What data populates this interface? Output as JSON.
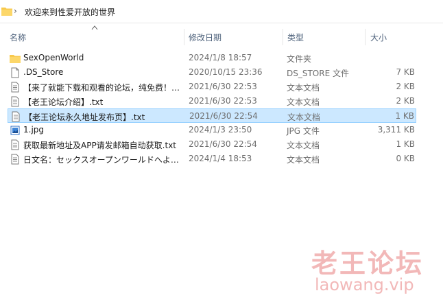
{
  "breadcrumb": {
    "separator": "›",
    "current": "欢迎来到性爱开放的世界"
  },
  "columns": {
    "name": "名称",
    "date": "修改日期",
    "type": "类型",
    "size": "大小"
  },
  "files": [
    {
      "icon": "folder-icon",
      "name": "SexOpenWorld",
      "date": "2024/1/8 18:57",
      "type": "文件夹",
      "size": ""
    },
    {
      "icon": "file-icon",
      "name": ".DS_Store",
      "date": "2020/10/15 23:36",
      "type": "DS_STORE 文件",
      "size": "7 KB"
    },
    {
      "icon": "text-document-icon",
      "name": "【来了就能下载和观看的论坛，纯免费！…",
      "date": "2021/6/30 22:53",
      "type": "文本文档",
      "size": "2 KB"
    },
    {
      "icon": "text-document-icon",
      "name": "【老王论坛介绍】.txt",
      "date": "2021/6/30 22:53",
      "type": "文本文档",
      "size": "2 KB"
    },
    {
      "icon": "text-document-icon",
      "name": "【老王论坛永久地址发布页】.txt",
      "date": "2021/6/30 22:54",
      "type": "文本文档",
      "size": "1 KB"
    },
    {
      "icon": "image-file-icon",
      "name": "1.jpg",
      "date": "2024/1/3 23:50",
      "type": "JPG 文件",
      "size": "3,311 KB"
    },
    {
      "icon": "text-document-icon",
      "name": "获取最新地址及APP请发邮箱自动获取.txt",
      "date": "2021/6/30 22:54",
      "type": "文本文档",
      "size": "1 KB"
    },
    {
      "icon": "text-document-icon",
      "name": "日文名：セックスオープンワールドへよ…",
      "date": "2024/1/4 18:53",
      "type": "文本文档",
      "size": "0 KB"
    }
  ],
  "watermark": {
    "title": "老王论坛",
    "url": "laowang.vip"
  }
}
